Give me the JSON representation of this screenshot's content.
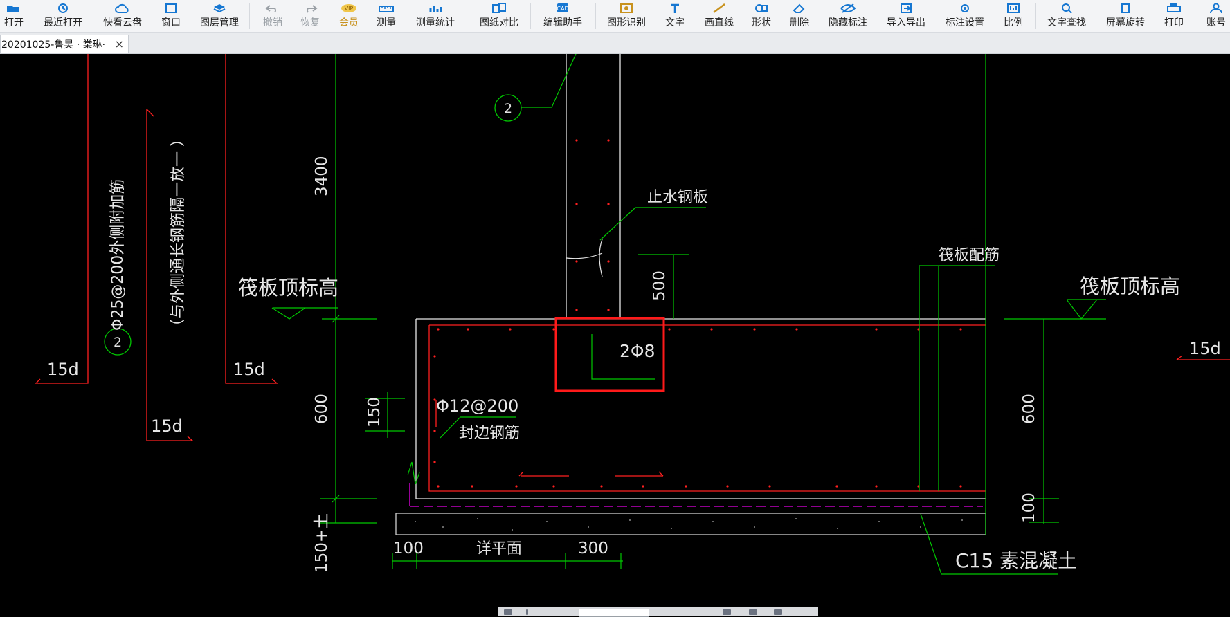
{
  "toolbar": {
    "items": [
      {
        "label": "打开",
        "icon": "folder-open-icon"
      },
      {
        "label": "最近打开",
        "icon": "history-icon"
      },
      {
        "label": "快看云盘",
        "icon": "cloud-icon"
      },
      {
        "label": "窗口",
        "icon": "window-icon"
      },
      {
        "label": "图层管理",
        "icon": "layers-icon"
      },
      {
        "label": "撤销",
        "icon": "undo-icon",
        "disabled": true
      },
      {
        "label": "恢复",
        "icon": "redo-icon",
        "disabled": true
      },
      {
        "label": "会员",
        "icon": "vip-icon",
        "vip": true
      },
      {
        "label": "测量",
        "icon": "ruler-icon"
      },
      {
        "label": "测量统计",
        "icon": "measure-stats-icon"
      },
      {
        "label": "图纸对比",
        "icon": "compare-icon"
      },
      {
        "label": "编辑助手",
        "icon": "edit-assistant-icon"
      },
      {
        "label": "图形识别",
        "icon": "shape-recognition-icon"
      },
      {
        "label": "文字",
        "icon": "text-icon"
      },
      {
        "label": "画直线",
        "icon": "line-icon"
      },
      {
        "label": "形状",
        "icon": "shape-icon"
      },
      {
        "label": "删除",
        "icon": "eraser-icon"
      },
      {
        "label": "隐藏标注",
        "icon": "eye-hide-icon"
      },
      {
        "label": "导入导出",
        "icon": "import-export-icon"
      },
      {
        "label": "标注设置",
        "icon": "annotation-settings-icon"
      },
      {
        "label": "比例",
        "icon": "scale-icon"
      },
      {
        "label": "文字查找",
        "icon": "text-search-icon"
      },
      {
        "label": "屏幕旋转",
        "icon": "rotate-screen-icon"
      },
      {
        "label": "打印",
        "icon": "print-icon"
      },
      {
        "label": "账号",
        "icon": "account-icon"
      }
    ],
    "accent": "#1677d2",
    "vip_color": "#c8921e"
  },
  "tabs": {
    "active_label": "20201025-鲁昊 · 棠琳·",
    "close_glyph": "×"
  },
  "drawing": {
    "colors": {
      "green": "#00c800",
      "red": "#ff2020",
      "white": "#e8e8e8",
      "magenta": "#c000c0",
      "highlight": "#ff1a1a"
    },
    "labels": {
      "rebar_left": "Φ25@200外侧附加筋",
      "rebar_left_note": "（与外侧通长钢筋隔一放一  ）",
      "circle_marker": "2",
      "raft_top_left": "筏板顶标高",
      "raft_top_right": "筏板顶标高",
      "d15_a": "15d",
      "d15_b": "15d",
      "d15_c": "15d",
      "d15_right": "15d",
      "dim_3400": "3400",
      "dim_500": "500",
      "dim_600_left": "600",
      "dim_600_right": "600",
      "dim_150": "150",
      "dim_100_right": "100",
      "dim_150_soil": "150+土",
      "dim_100_bottom": "100",
      "dim_300_bottom": "300",
      "waterstop": "止水钢板",
      "raft_rebar": "筏板配筋",
      "rebar_2phi8": "2Φ8",
      "edge_rebar_spec": "Φ12@200",
      "edge_rebar": "封边钢筋",
      "detail_plane": "详平面",
      "concrete": "C15  素混凝土"
    }
  },
  "statusbar": {
    "icons": [
      "zoom-fit-icon",
      "pan-icon",
      "select-icon",
      "rotate-icon",
      "layers-mini-icon"
    ]
  }
}
